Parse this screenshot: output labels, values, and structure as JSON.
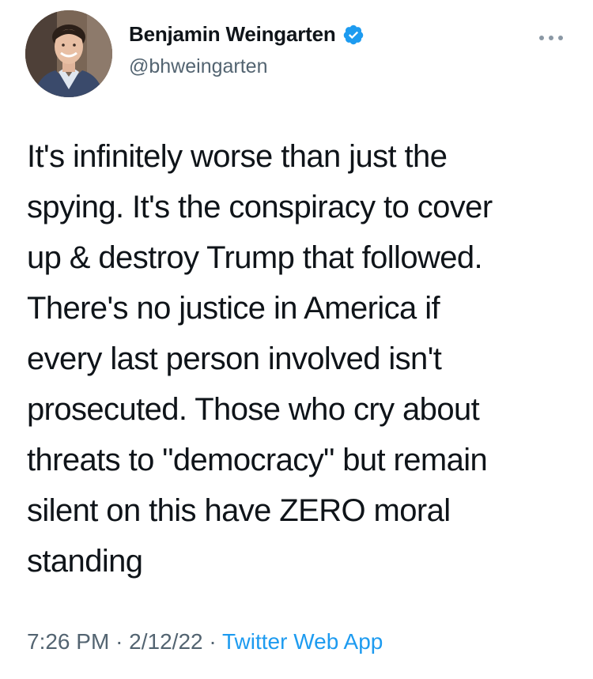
{
  "author": {
    "display_name": "Benjamin Weingarten",
    "handle": "@bhweingarten",
    "verified": true,
    "verified_icon": "verified-badge-icon",
    "verified_color": "#1d9bf0"
  },
  "tweet": {
    "text": "It's infinitely worse than just the\nspying. It's the conspiracy to cover\nup & destroy Trump that followed.\nThere's no justice in America if\nevery last person involved isn't\nprosecuted. Those who cry about\nthreats to \"democracy\" but remain\nsilent on this have ZERO moral\nstanding",
    "time": "7:26 PM",
    "date": "2/12/22",
    "separator": "·",
    "source": "Twitter Web App"
  },
  "actions": {
    "more_icon": "more-horizontal-icon"
  },
  "colors": {
    "text": "#0f1419",
    "secondary": "#536471",
    "link": "#1d9bf0",
    "background": "#ffffff"
  }
}
